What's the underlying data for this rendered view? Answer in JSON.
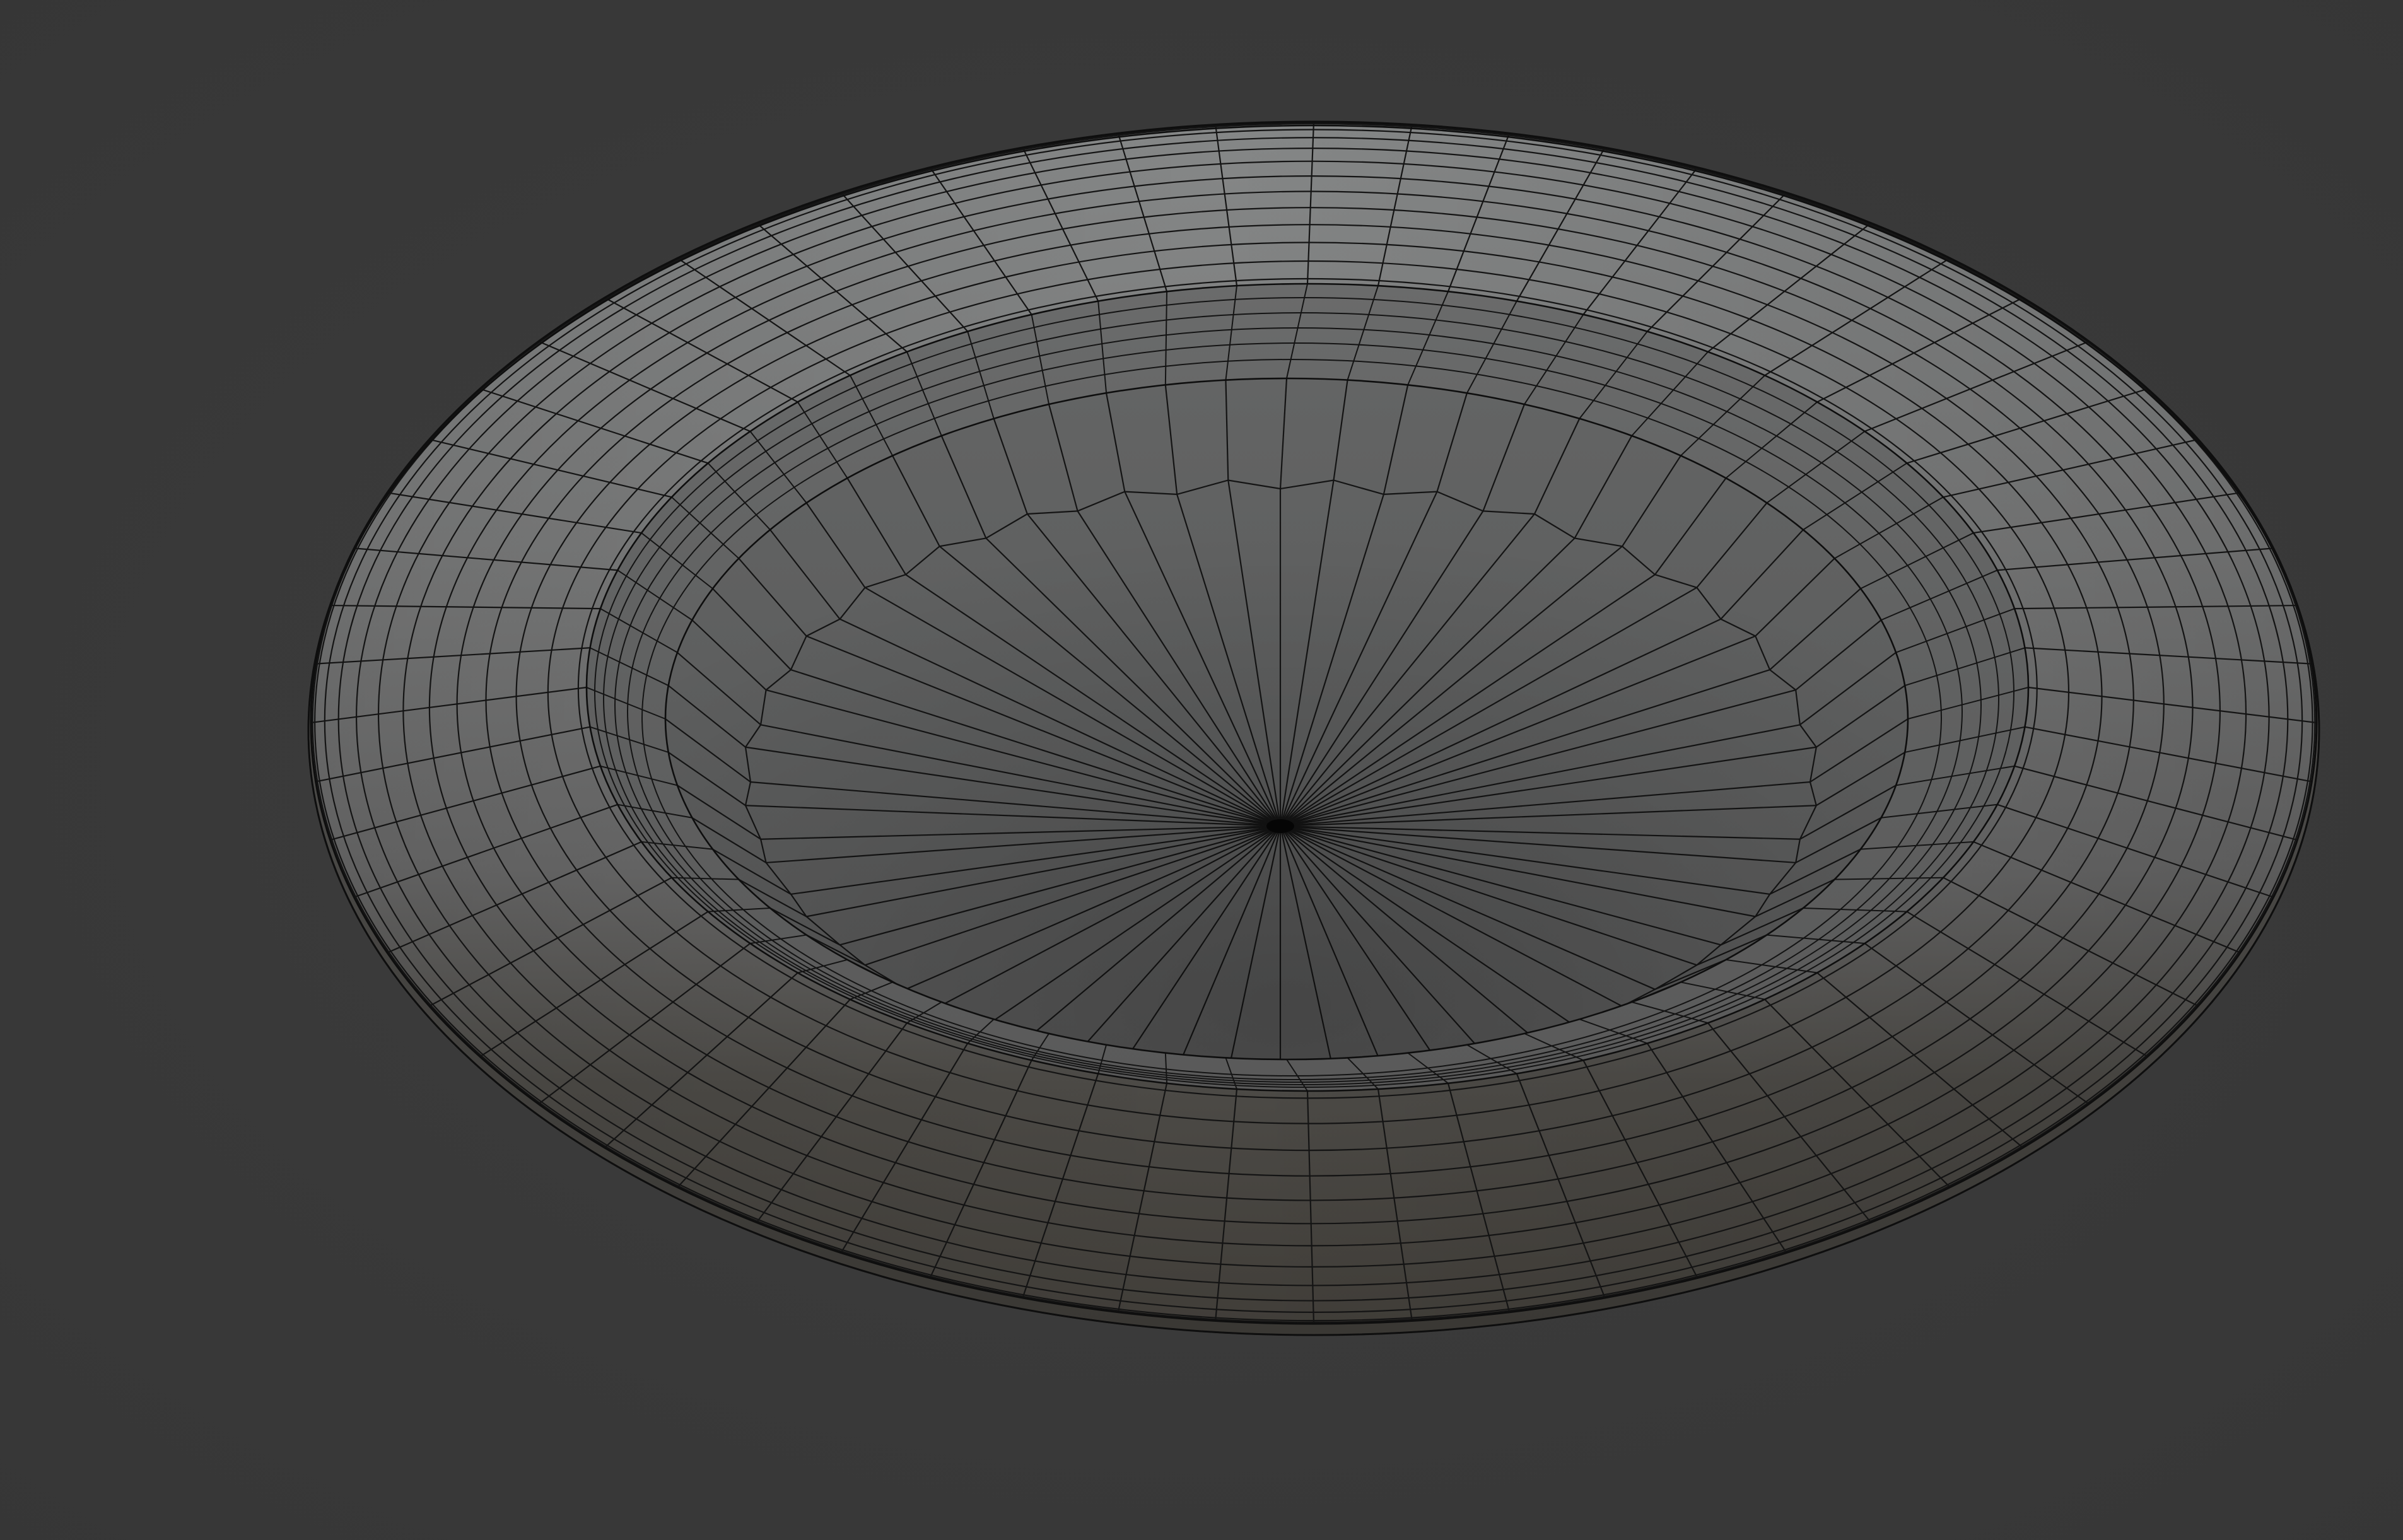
{
  "viewport": {
    "background_color": "#3a3a3a",
    "shading": "solid",
    "overlay": "wireframe"
  },
  "mesh": {
    "object": "plate",
    "surface_color": "#7d7e7e",
    "shadow_tint": "#3c3933",
    "wire_color": "#141414",
    "radial_segments": 64,
    "center_pole": true
  }
}
